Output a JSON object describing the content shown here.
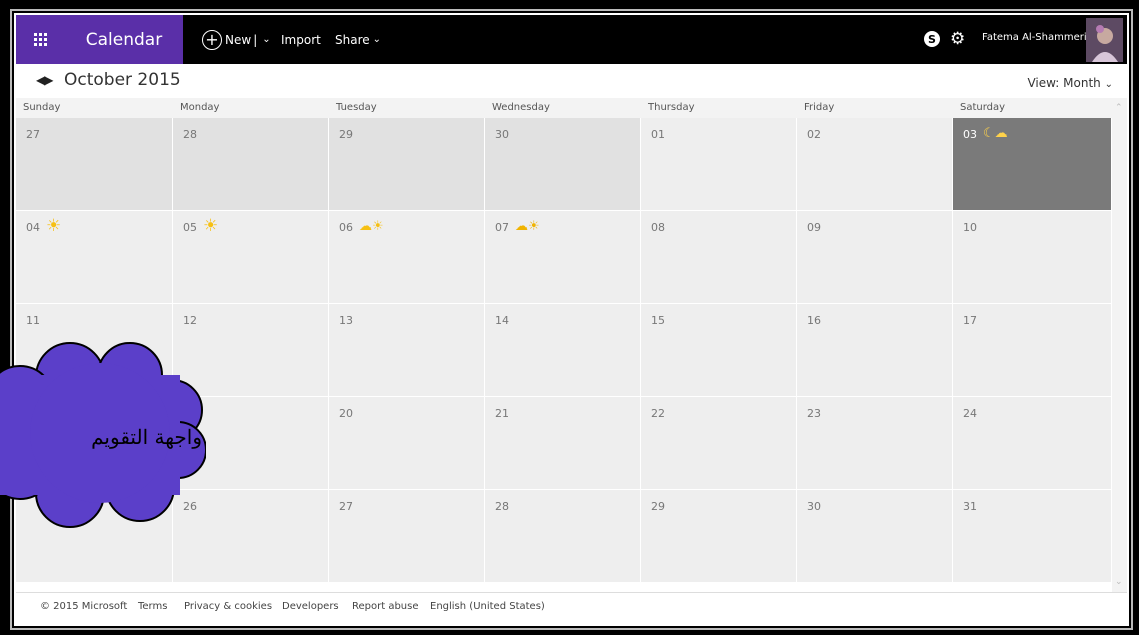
{
  "header": {
    "app_title": "Calendar",
    "new_label": "New",
    "import_label": "Import",
    "share_label": "Share",
    "user_name": "Fatema Al-Shammeri"
  },
  "subheader": {
    "month_title": "October 2015",
    "view_label": "View: Month"
  },
  "calendar": {
    "weekdays": [
      "Sunday",
      "Monday",
      "Tuesday",
      "Wednesday",
      "Thursday",
      "Friday",
      "Saturday"
    ],
    "weeks": [
      [
        "27",
        "28",
        "29",
        "30",
        "01",
        "02",
        "03"
      ],
      [
        "04",
        "05",
        "06",
        "07",
        "08",
        "09",
        "10"
      ],
      [
        "11",
        "12",
        "13",
        "14",
        "15",
        "16",
        "17"
      ],
      [
        "",
        "",
        "20",
        "21",
        "22",
        "23",
        "24"
      ],
      [
        "",
        "26",
        "27",
        "28",
        "29",
        "30",
        "31"
      ]
    ],
    "weather": [
      {
        "day": "03",
        "icon": "moon-cloud-icon"
      },
      {
        "day": "04",
        "icon": "sun-icon"
      },
      {
        "day": "05",
        "icon": "sun-icon"
      },
      {
        "day": "06",
        "icon": "partly-sunny-icon"
      },
      {
        "day": "07",
        "icon": "cloudy-sun-icon"
      }
    ]
  },
  "footer": {
    "copyright": "© 2015 Microsoft",
    "terms": "Terms",
    "privacy": "Privacy & cookies",
    "developers": "Developers",
    "report_abuse": "Report abuse",
    "language": "English (United States)"
  },
  "annotation": {
    "text": "واجهة التقويم",
    "fill_color": "#5b3fc9"
  }
}
